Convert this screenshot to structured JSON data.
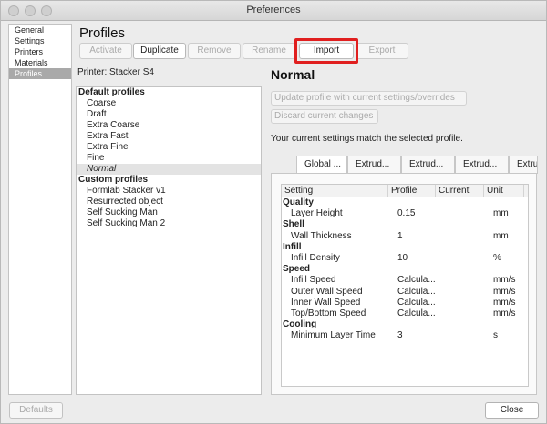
{
  "window": {
    "title": "Preferences"
  },
  "sidebar": {
    "items": [
      "General",
      "Settings",
      "Printers",
      "Materials",
      "Profiles"
    ],
    "selected": "Profiles"
  },
  "page": {
    "heading": "Profiles"
  },
  "toolbar": {
    "activate": "Activate",
    "duplicate": "Duplicate",
    "remove": "Remove",
    "rename": "Rename",
    "import": "Import",
    "export": "Export"
  },
  "printer_label": "Printer: Stacker S4",
  "profiles": {
    "default_header": "Default profiles",
    "default_items": [
      "Coarse",
      "Draft",
      "Extra Coarse",
      "Extra Fast",
      "Extra Fine",
      "Fine",
      "Normal"
    ],
    "selected": "Normal",
    "custom_header": "Custom profiles",
    "custom_items": [
      "Formlab Stacker v1",
      "Resurrected object",
      "Self Sucking Man",
      "Self Sucking Man 2"
    ]
  },
  "detail": {
    "title": "Normal",
    "update_button": "Update profile with current settings/overrides",
    "discard_button": "Discard current changes",
    "status_text": "Your current settings match the selected profile.",
    "tabs": [
      "Global ...",
      "Extrud...",
      "Extrud...",
      "Extrud...",
      "Extrud..."
    ]
  },
  "settings_table": {
    "headers": {
      "setting": "Setting",
      "profile": "Profile",
      "current": "Current",
      "unit": "Unit"
    },
    "rows": [
      {
        "kind": "category",
        "name": "Quality"
      },
      {
        "kind": "setting",
        "name": "Layer Height",
        "profile": "0.15",
        "current": "",
        "unit": "mm"
      },
      {
        "kind": "category",
        "name": "Shell"
      },
      {
        "kind": "setting",
        "name": "Wall Thickness",
        "profile": "1",
        "current": "",
        "unit": "mm"
      },
      {
        "kind": "category",
        "name": "Infill"
      },
      {
        "kind": "setting",
        "name": "Infill Density",
        "profile": "10",
        "current": "",
        "unit": "%"
      },
      {
        "kind": "category",
        "name": "Speed"
      },
      {
        "kind": "setting",
        "name": "Infill Speed",
        "profile": "Calcula...",
        "current": "",
        "unit": "mm/s"
      },
      {
        "kind": "setting",
        "name": "Outer Wall Speed",
        "profile": "Calcula...",
        "current": "",
        "unit": "mm/s"
      },
      {
        "kind": "setting",
        "name": "Inner Wall Speed",
        "profile": "Calcula...",
        "current": "",
        "unit": "mm/s"
      },
      {
        "kind": "setting",
        "name": "Top/Bottom Speed",
        "profile": "Calcula...",
        "current": "",
        "unit": "mm/s"
      },
      {
        "kind": "category",
        "name": "Cooling"
      },
      {
        "kind": "setting",
        "name": "Minimum Layer Time",
        "profile": "3",
        "current": "",
        "unit": "s"
      }
    ]
  },
  "footer": {
    "defaults": "Defaults",
    "close": "Close"
  },
  "colors": {
    "highlight": "#e01f1f",
    "selection": "#a9a9a9"
  }
}
